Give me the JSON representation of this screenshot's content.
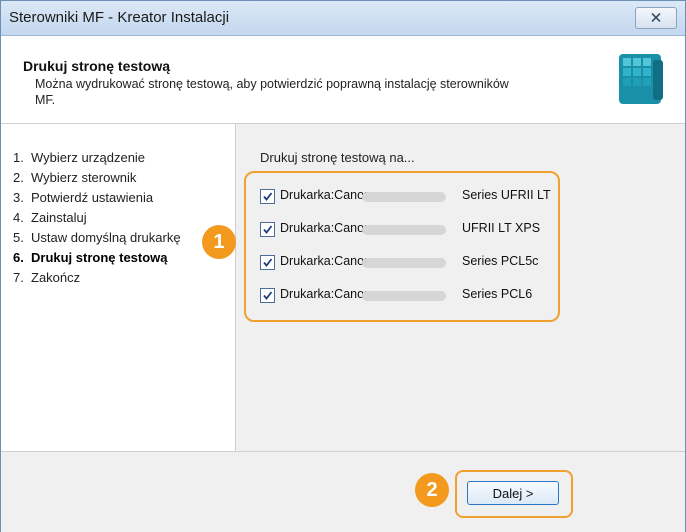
{
  "window": {
    "title": "Sterowniki MF - Kreator Instalacji"
  },
  "header": {
    "title": "Drukuj stronę testową",
    "description": "Można wydrukować stronę testową, aby potwierdzić poprawną instalację sterowników MF."
  },
  "steps": [
    {
      "num": "1.",
      "label": "Wybierz urządzenie"
    },
    {
      "num": "2.",
      "label": "Wybierz sterownik"
    },
    {
      "num": "3.",
      "label": "Potwierdź ustawienia"
    },
    {
      "num": "4.",
      "label": "Zainstaluj"
    },
    {
      "num": "5.",
      "label": "Ustaw domyślną drukarkę"
    },
    {
      "num": "6.",
      "label": "Drukuj stronę testową",
      "active": true
    },
    {
      "num": "7.",
      "label": "Zakończ"
    }
  ],
  "content": {
    "prompt": "Drukuj stronę testową na...",
    "printers": [
      {
        "name": "Drukarka:Canon",
        "series": "Series UFRII LT",
        "checked": true
      },
      {
        "name": "Drukarka:Canon",
        "series": "UFRII LT XPS",
        "checked": true
      },
      {
        "name": "Drukarka:Canon",
        "series": "Series PCL5c",
        "checked": true
      },
      {
        "name": "Drukarka:Canon",
        "series": "Series PCL6",
        "checked": true
      }
    ]
  },
  "footer": {
    "next_label": "Dalej >"
  },
  "callouts": {
    "one": "1",
    "two": "2"
  },
  "colors": {
    "accent": "#f39a1e",
    "highlight_border": "#f0a030",
    "titlebar": "#c3d7ee"
  },
  "icons": {
    "close": "close-icon",
    "header": "canon-installer-icon",
    "check": "check-icon"
  }
}
